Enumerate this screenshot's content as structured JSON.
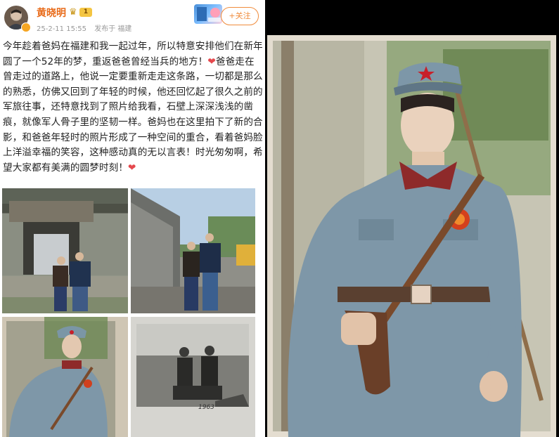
{
  "post": {
    "author": "黄晓明",
    "level_badge": "1",
    "timestamp": "25-2-11 15:55",
    "location": "发布于 福建",
    "follow_label": "+关注",
    "text_before_heart1": "今年趁着爸妈在福建和我一起过年，所以特意安排他们在新年圆了一个52年的梦，重返爸爸曾经当兵的地方！",
    "text_after_heart1": "爸爸走在曾走过的道路上，他说一定要重新走走这条路，一切都是那么的熟悉，仿佛又回到了年轻的时候，他还回忆起了很久之前的军旅往事，还特意找到了照片给我看，石壁上深深浅浅的凿痕，就像军人骨子里的坚韧一样。爸妈也在这里拍下了新的合影，和爸爸年轻时的照片形成了一种空间的重合，看着爸妈脸上洋溢幸福的笑容，这种感动真的无以言表！时光匆匆啊，希望大家都有美满的圆梦时刻！",
    "photo_caption": "1963"
  },
  "colors": {
    "author": "#e86b1a",
    "follow": "#f08c3c",
    "heart": "#e5484d",
    "uniform": "#7e97a8",
    "collar": "#8e2a2a",
    "star": "#c8202a"
  },
  "icons": [
    "avatar",
    "vip-crown-icon",
    "heart-icon",
    "sticker"
  ]
}
